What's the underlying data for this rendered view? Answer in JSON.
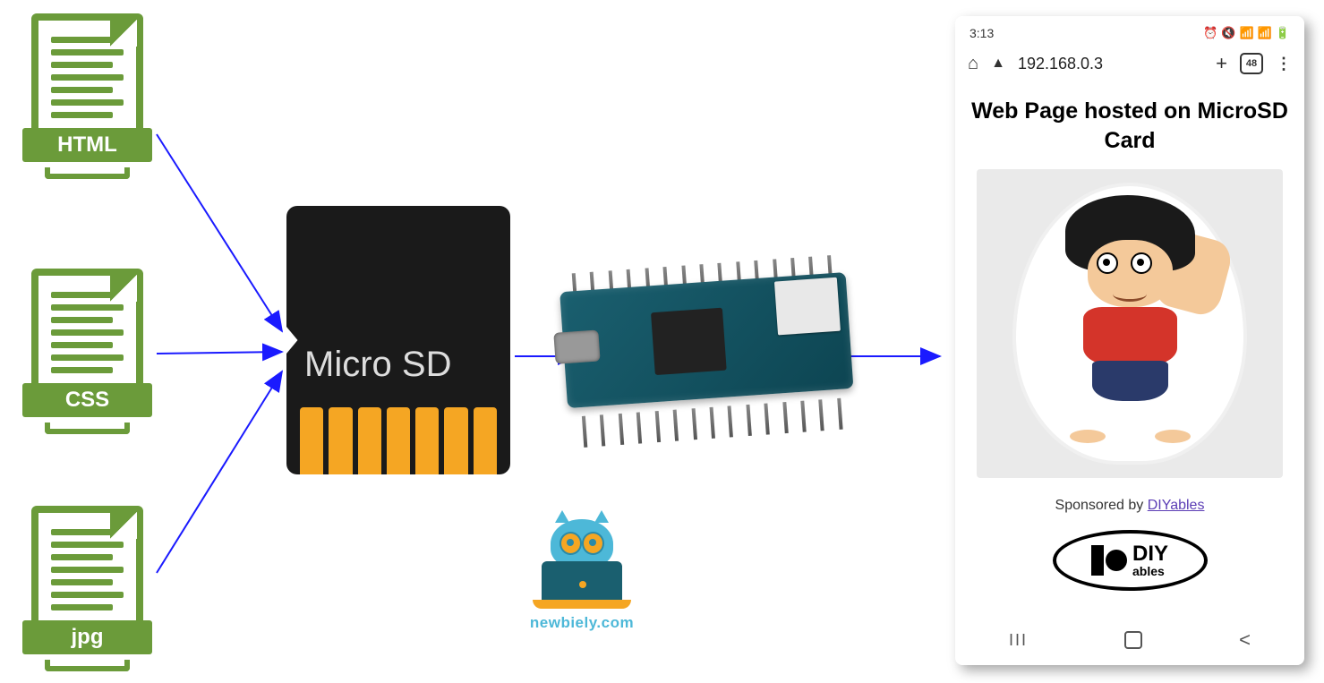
{
  "files": {
    "html": "HTML",
    "css": "CSS",
    "jpg": "jpg"
  },
  "sd_card": {
    "label": "Micro SD"
  },
  "logo": {
    "site": "newbiely.com"
  },
  "phone": {
    "time": "3:13",
    "url": "192.168.0.3",
    "tab_count": "48",
    "title": "Web Page hosted on MicroSD Card",
    "sponsor_prefix": "Sponsored by ",
    "sponsor_link": "DIYables",
    "diy": {
      "big": "DIY",
      "small": "ables"
    },
    "nav": {
      "recents": "III",
      "back": "<"
    }
  }
}
